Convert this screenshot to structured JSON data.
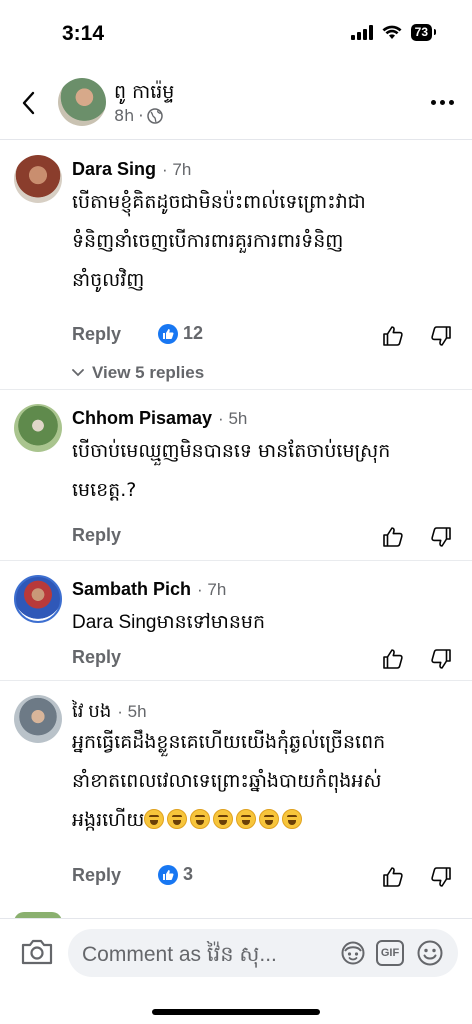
{
  "status_bar": {
    "time": "3:14",
    "battery": "73"
  },
  "header": {
    "back_icon": "chevron-left-icon",
    "name": "ពូ ការ៉េម្ទ",
    "time": "8h",
    "privacy_icon": "globe-icon",
    "more_icon": "more-horizontal-icon"
  },
  "comments": [
    {
      "author": "Dara Sing",
      "time": "7h",
      "lines": [
        "បើតាមខ្ញុំគិតដូចជាមិនប៉ះពាល់ទេព្រោះវាជា",
        "ទំនិញនាំចេញបើការពារគួរការពារទំនិញ",
        "នាំចូលវិញ"
      ],
      "reply_label": "Reply",
      "reaction_count": "12",
      "view_replies": "View 5 replies"
    },
    {
      "author": "Chhom Pisamay",
      "time": "5h",
      "lines": [
        "បើចាប់មេឈ្មួញមិនបានទេ មានតែចាប់មេស្រុក",
        "មេខេត្ត.?"
      ],
      "reply_label": "Reply"
    },
    {
      "author": "Sambath Pich",
      "time": "7h",
      "mention": "Dara Sing",
      "text": "មានទៅមានមក",
      "reply_label": "Reply"
    },
    {
      "author": "វៃ បង",
      "time": "5h",
      "lines": [
        "អ្នកធ្វើគេដឹងខ្លួនគេហើយយើងកុំឆ្ងល់ច្រើនពេក",
        "នាំខាតពេលវេលាទេព្រោះឆ្នាំងបាយកំពុងអស់"
      ],
      "last_line": "អង្ករហើយ",
      "emoji_count": 7,
      "reply_label": "Reply",
      "reaction_count": "3"
    }
  ],
  "composer": {
    "placeholder": "Comment as វ៉ៃន សុ...",
    "gif_label": "GIF"
  }
}
